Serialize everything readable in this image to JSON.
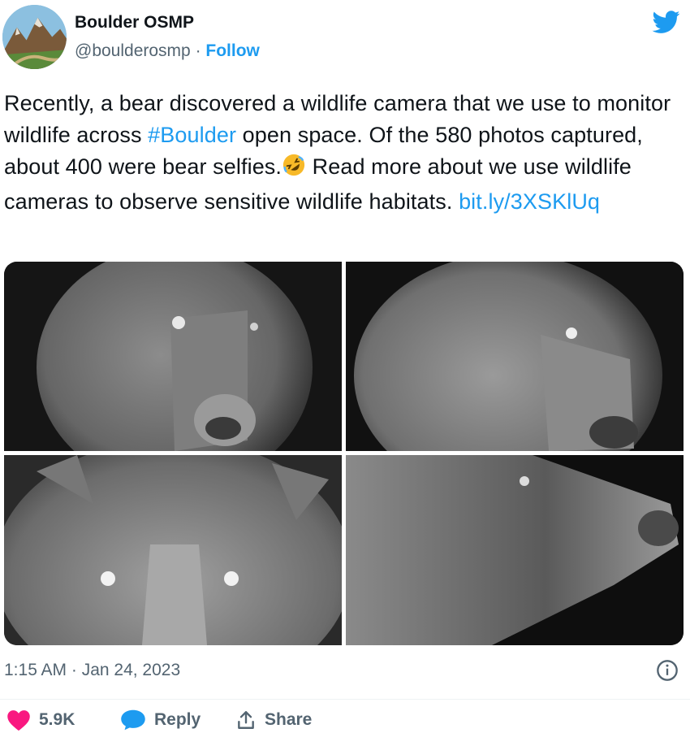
{
  "author": {
    "name": "Boulder OSMP",
    "handle": "@boulderosmp",
    "separator": " · ",
    "follow_label": "Follow"
  },
  "tweet": {
    "text_1": "Recently, a bear discovered a wildlife camera that we use to monitor wildlife across ",
    "hashtag": "#Boulder",
    "text_2": " open space. Of the 580 photos captured, about 400 were bear selfies.",
    "emoji": "rolling-on-floor-laughing-emoji",
    "text_3": " Read more about we use wildlife cameras to observe sensitive wildlife habitats. ",
    "link": "bit.ly/3XSKlUq"
  },
  "media": {
    "photos": [
      "bear-selfie-1",
      "bear-selfie-2",
      "bear-selfie-3",
      "bear-selfie-4"
    ]
  },
  "timestamp": "1:15 AM · Jan 24, 2023",
  "actions": {
    "likes": "5.9K",
    "reply_label": "Reply",
    "share_label": "Share"
  },
  "colors": {
    "accent": "#1d9bf0",
    "like": "#f91880",
    "secondary_text": "#536471"
  },
  "icons": {
    "brand": "twitter-bird-icon",
    "info": "info-icon",
    "like": "heart-icon",
    "reply": "reply-bubble-icon",
    "share": "share-icon"
  }
}
